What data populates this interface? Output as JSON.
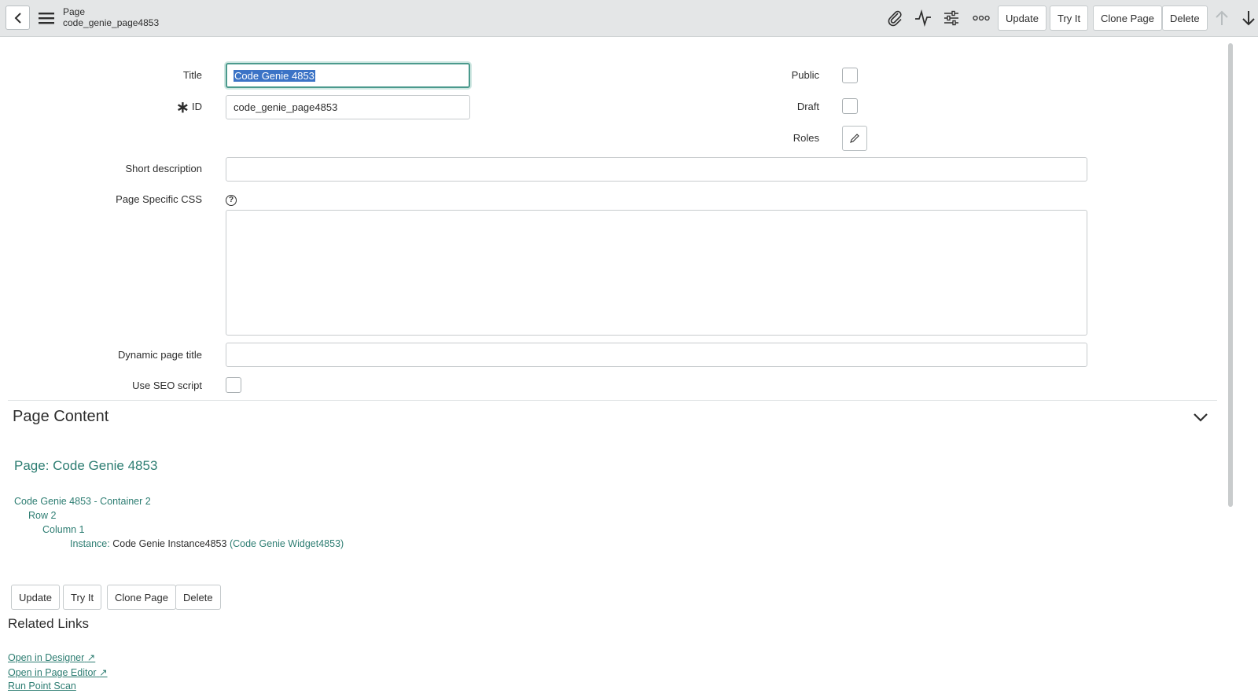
{
  "header": {
    "table_label": "Page",
    "record_name": "code_genie_page4853",
    "buttons": {
      "update": "Update",
      "try_it": "Try It",
      "clone_page": "Clone Page",
      "delete": "Delete"
    },
    "icons": [
      "back-icon",
      "hamburger-menu-icon",
      "paperclip-icon",
      "activity-icon",
      "personalize-icon",
      "more-options-icon",
      "arrow-up-icon",
      "arrow-down-icon"
    ]
  },
  "form": {
    "title_label": "Title",
    "title_value": "Code Genie 4853",
    "id_label": "ID",
    "id_value": "code_genie_page4853",
    "public_label": "Public",
    "draft_label": "Draft",
    "roles_label": "Roles",
    "short_description_label": "Short description",
    "short_description_value": "",
    "page_css_label": "Page Specific CSS",
    "page_css_value": "",
    "dynamic_title_label": "Dynamic page title",
    "dynamic_title_value": "",
    "seo_label": "Use SEO script",
    "mandatory_mark": "∗",
    "help_mark": "?"
  },
  "page_content": {
    "section_title": "Page Content",
    "page_link": "Page: Code Genie 4853",
    "container": "Code Genie 4853 - Container 2",
    "row": "Row 2",
    "column": "Column 1",
    "instance_label": "Instance:",
    "instance_name": "Code Genie Instance4853",
    "widget_open": "(",
    "widget_name": "Code Genie Widget4853",
    "widget_close": ")"
  },
  "bottom_buttons": {
    "update": "Update",
    "try_it": "Try It",
    "clone_page": "Clone Page",
    "delete": "Delete"
  },
  "related_links": {
    "title": "Related Links",
    "links": [
      "Open in Designer",
      "Open in Page Editor",
      "Run Point Scan"
    ],
    "external_mark": "↗"
  },
  "colors": {
    "accent": "#2d7d72",
    "header_bg": "#e4e6e7",
    "selection": "#3b73c6"
  }
}
